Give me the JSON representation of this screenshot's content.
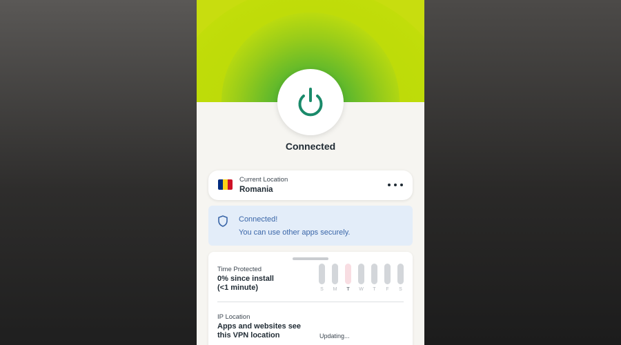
{
  "app": {
    "status": "Connected"
  },
  "location": {
    "label": "Current Location",
    "country": "Romania",
    "flag_colors": [
      "#002B7F",
      "#FCD116",
      "#CE1126"
    ]
  },
  "notice": {
    "title": "Connected!",
    "message": "You can use other apps securely."
  },
  "time_protected": {
    "label": "Time Protected",
    "line1": "0% since install",
    "line2": "(<1 minute)",
    "days": [
      "S",
      "M",
      "T",
      "W",
      "T",
      "F",
      "S"
    ],
    "active_day_index": 2
  },
  "ip_location": {
    "label": "IP Location",
    "line1": "Apps and websites see",
    "line2": "this VPN location",
    "status": "Updating..."
  },
  "icons": {
    "power": "power-icon",
    "shield": "shield-icon",
    "more": "more-icon"
  },
  "colors": {
    "accent_green": "#1a8a6a",
    "hero_lime": "#c8dd0f",
    "notice_bg": "#e3edf9",
    "notice_text": "#3a66a8"
  }
}
